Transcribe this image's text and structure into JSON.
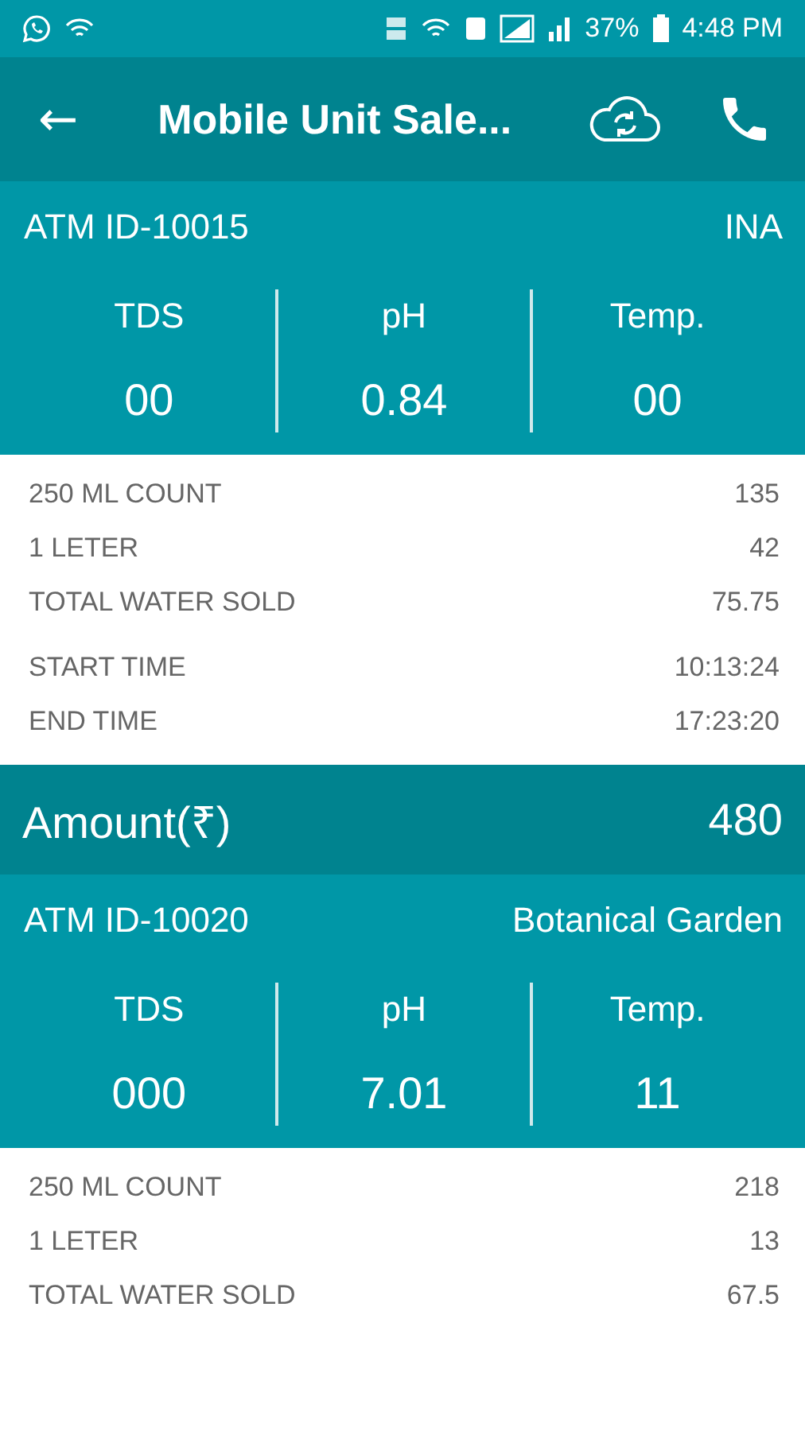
{
  "status_bar": {
    "battery": "37%",
    "time": "4:48 PM"
  },
  "app_bar": {
    "back_icon": "←",
    "title": "Mobile Unit Sale..."
  },
  "units": [
    {
      "atm_id": "ATM ID-10015",
      "location": "INA",
      "metrics": [
        {
          "label": "TDS",
          "value": "00"
        },
        {
          "label": "pH",
          "value": "0.84"
        },
        {
          "label": "Temp.",
          "value": "00"
        }
      ],
      "counts": [
        {
          "label": "250 ML COUNT",
          "value": "135"
        },
        {
          "label": "1 LETER",
          "value": "42"
        },
        {
          "label": "TOTAL WATER SOLD",
          "value": "75.75"
        }
      ],
      "times": [
        {
          "label": "START TIME",
          "value": "10:13:24"
        },
        {
          "label": "END TIME",
          "value": "17:23:20"
        }
      ],
      "amount": {
        "label": "Amount(₹)",
        "value": "480"
      }
    },
    {
      "atm_id": "ATM ID-10020",
      "location": "Botanical Garden",
      "metrics": [
        {
          "label": "TDS",
          "value": "000"
        },
        {
          "label": "pH",
          "value": "7.01"
        },
        {
          "label": "Temp.",
          "value": "11"
        }
      ],
      "counts": [
        {
          "label": "250 ML COUNT",
          "value": "218"
        },
        {
          "label": "1 LETER",
          "value": "13"
        },
        {
          "label": "TOTAL WATER SOLD",
          "value": "67.5"
        }
      ]
    }
  ]
}
